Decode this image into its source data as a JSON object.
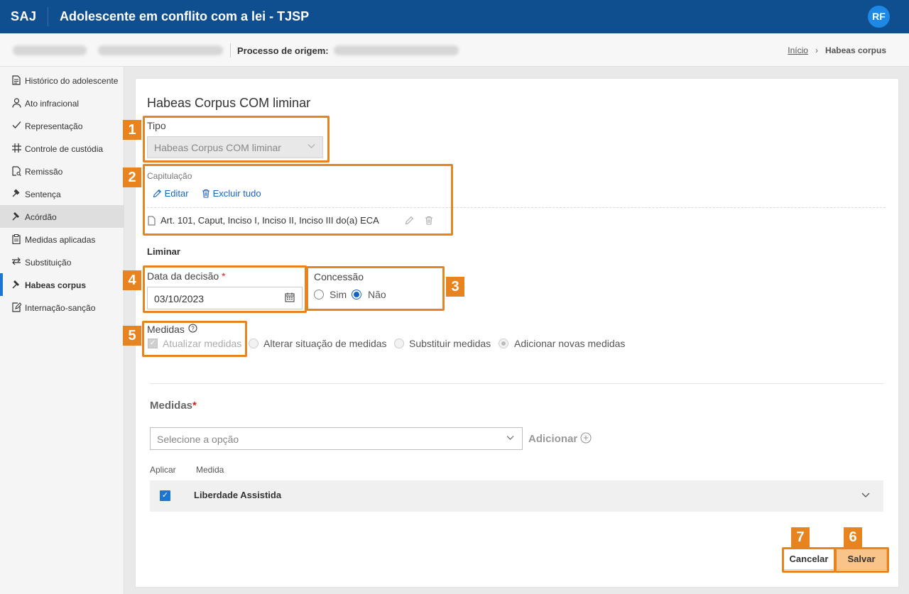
{
  "header": {
    "logo": "SAJ",
    "title": "Adolescente em conflito com a lei - TJSP",
    "avatar": "RF"
  },
  "subheader": {
    "origin_label": "Processo de origem:",
    "breadcrumb": {
      "home": "Início",
      "separator": "›",
      "current": "Habeas corpus"
    }
  },
  "sidebar": {
    "items": [
      {
        "label": "Histórico do adolescente",
        "icon": "document-icon"
      },
      {
        "label": "Ato infracional",
        "icon": "person-icon"
      },
      {
        "label": "Representação",
        "icon": "check-icon"
      },
      {
        "label": "Controle de custódia",
        "icon": "grid-icon"
      },
      {
        "label": "Remissão",
        "icon": "document-search-icon"
      },
      {
        "label": "Sentença",
        "icon": "gavel-icon"
      },
      {
        "label": "Acórdão",
        "icon": "gavel-icon"
      },
      {
        "label": "Medidas aplicadas",
        "icon": "clipboard-icon"
      },
      {
        "label": "Substituição",
        "icon": "swap-icon"
      },
      {
        "label": "Habeas corpus",
        "icon": "gavel-icon"
      },
      {
        "label": "Internação-sanção",
        "icon": "edit-document-icon"
      }
    ]
  },
  "form": {
    "title": "Habeas Corpus COM liminar",
    "tipo": {
      "label": "Tipo",
      "value": "Habeas Corpus COM liminar"
    },
    "capitulacao": {
      "label": "Capitulação",
      "edit": "Editar",
      "delete_all": "Excluir tudo",
      "item": "Art. 101, Caput, Inciso I, Inciso II, Inciso III do(a) ECA"
    },
    "liminar": {
      "heading": "Liminar",
      "data_label": "Data da decisão",
      "required_mark": "*",
      "data_value": "03/10/2023",
      "concessao_label": "Concessão",
      "sim": "Sim",
      "nao": "Não",
      "concessao_selected": "Não"
    },
    "medidas_opts": {
      "label": "Medidas",
      "help": "?",
      "atualizar": "Atualizar medidas",
      "alterar": "Alterar situação de medidas",
      "substituir": "Substituir medidas",
      "adicionar": "Adicionar novas medidas"
    },
    "medidas": {
      "heading": "Medidas",
      "required_mark": "*",
      "placeholder": "Selecione a opção",
      "add": "Adicionar",
      "col_aplicar": "Aplicar",
      "col_medida": "Medida",
      "row": "Liberdade Assistida"
    },
    "buttons": {
      "cancel": "Cancelar",
      "save": "Salvar"
    }
  },
  "callouts": [
    "1",
    "2",
    "3",
    "4",
    "5",
    "6",
    "7"
  ],
  "colors": {
    "header": "#0f4f8f",
    "accent": "#1976d2",
    "callout": "#e8841f",
    "save": "#f9c48a"
  }
}
